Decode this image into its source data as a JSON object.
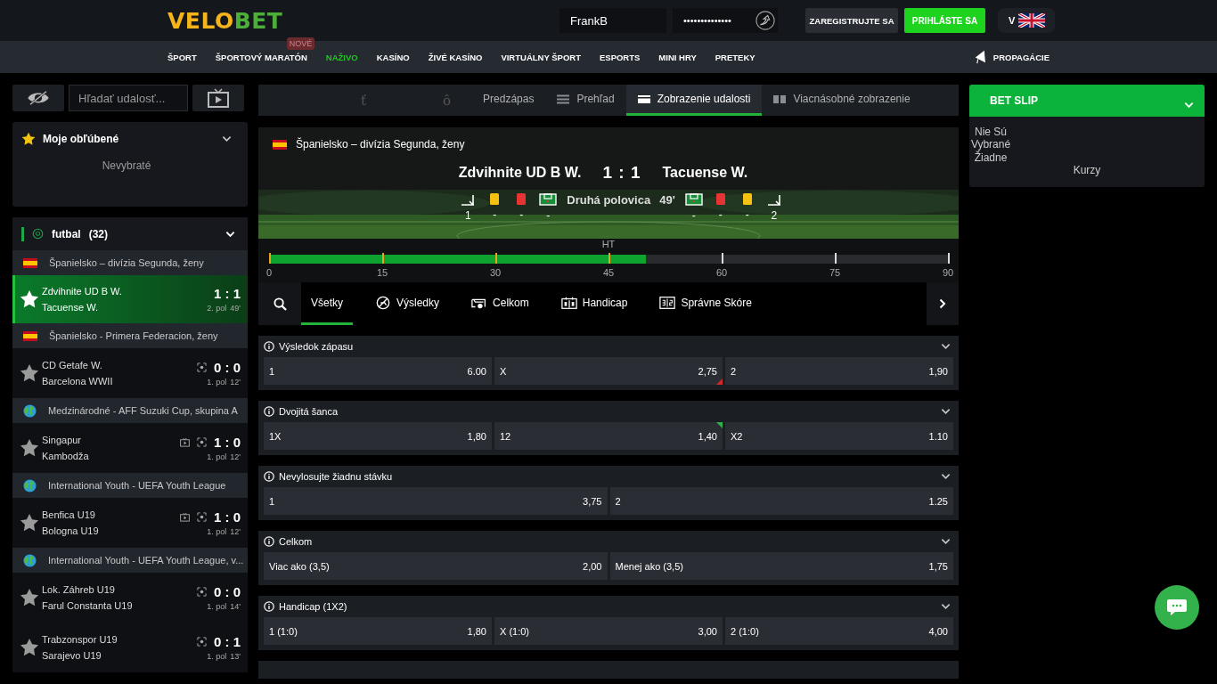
{
  "header": {
    "logo": {
      "first": "VELO",
      "second": "BET"
    },
    "username": {
      "value": "FrankB"
    },
    "password": {
      "value": "••••••••••••••"
    },
    "register_button": "ZAREGISTRUJTE SA",
    "login_button": "PRIHLÁSTE SA",
    "language": "V"
  },
  "nav": {
    "items": [
      {
        "label": "ŠPORT",
        "selected": false
      },
      {
        "label": "ŠPORTOVÝ MARATÓN",
        "selected": false,
        "badge": "NOVÉ"
      },
      {
        "label": "NAŽIVO",
        "selected": true
      },
      {
        "label": "KASÍNO",
        "selected": false
      },
      {
        "label": "ŽIVÉ KASÍNO",
        "selected": false
      },
      {
        "label": "VIRTUÁLNY ŠPORT",
        "selected": false
      },
      {
        "label": "ESPORTS",
        "selected": false
      },
      {
        "label": "MINI HRY",
        "selected": false
      },
      {
        "label": "PRETEKY",
        "selected": false
      }
    ],
    "promotions": "PROPAGÁCIE"
  },
  "sidebar": {
    "search": {
      "placeholder": "Hľadať udalosť..."
    },
    "favorites": {
      "title": "Moje obľúbené",
      "empty": "Nevybraté"
    },
    "sport": {
      "name": "futbal",
      "count": "(32)"
    },
    "groups": [
      {
        "league": "Španielsko – divízia Segunda, ženy",
        "kind": "spain",
        "matches": [
          {
            "home": "Zdvihnite UD B W.",
            "away": "Tacuense W.",
            "score": "1 : 1",
            "period": "2. pol",
            "minute": "49'",
            "selected": true,
            "tv": false,
            "tracker": false
          }
        ]
      },
      {
        "league": "Španielsko - Primera Federacion, ženy",
        "kind": "spain",
        "matches": [
          {
            "home": "CD Getafe W.",
            "away": "Barcelona WWII",
            "score": "0 : 0",
            "period": "1. pol",
            "minute": "12'",
            "selected": false,
            "tv": false,
            "tracker": true
          }
        ]
      },
      {
        "league": "Medzinárodné - AFF Suzuki Cup, skupina A",
        "kind": "world",
        "matches": [
          {
            "home": "Singapur",
            "away": "Kambodža",
            "score": "1 : 0",
            "period": "1. pol",
            "minute": "12'",
            "selected": false,
            "tv": true,
            "tracker": true
          }
        ]
      },
      {
        "league": "International Youth - UEFA Youth League",
        "kind": "world",
        "matches": [
          {
            "home": "Benfica U19",
            "away": "Bologna U19",
            "score": "1 : 0",
            "period": "1. pol",
            "minute": "12'",
            "selected": false,
            "tv": true,
            "tracker": true
          }
        ]
      },
      {
        "league": "International Youth - UEFA Youth League, v...",
        "kind": "world",
        "matches": [
          {
            "home": "Lok. Záhreb U19",
            "away": "Farul Constanta U19",
            "score": "0 : 0",
            "period": "1. pol",
            "minute": "14'",
            "selected": false,
            "tv": false,
            "tracker": true
          },
          {
            "home": "Trabzonspor U19",
            "away": "Sarajevo U19",
            "score": "0 : 1",
            "period": "1. pol",
            "minute": "13'",
            "selected": false,
            "tv": false,
            "tracker": true
          }
        ]
      }
    ]
  },
  "view_tabs": [
    {
      "kind": "glyph",
      "label": "ť",
      "selected": false
    },
    {
      "kind": "glyph",
      "label": "ô",
      "selected": false
    },
    {
      "kind": "plain",
      "label": "Predzápas",
      "selected": false
    },
    {
      "kind": "list",
      "label": "Prehľad",
      "selected": false
    },
    {
      "kind": "single",
      "label": "Zobrazenie udalosti",
      "selected": true
    },
    {
      "kind": "multi",
      "label": "Viacnásobné zobrazenie",
      "selected": false
    }
  ],
  "scoreboard": {
    "league": "Španielsko – divízia Segunda, ženy",
    "kind": "spain",
    "home": "Zdvihnite UD B W.",
    "score": "1 : 1",
    "away": "Tacuense W.",
    "period": "Druhá polovica",
    "minute": "49'",
    "home_stats": [
      {
        "kind": "corner",
        "value": "1"
      },
      {
        "kind": "yellow",
        "value": "-"
      },
      {
        "kind": "red",
        "value": "-"
      },
      {
        "kind": "penalty",
        "value": "-"
      }
    ],
    "away_stats": [
      {
        "kind": "penalty",
        "value": "-"
      },
      {
        "kind": "red",
        "value": "-"
      },
      {
        "kind": "yellow",
        "value": "-"
      },
      {
        "kind": "corner",
        "value": "2"
      }
    ]
  },
  "timeline": {
    "half_label": "HT",
    "level": 0.555,
    "ticks": [
      "0",
      "15",
      "30",
      "45",
      "60",
      "75",
      "90"
    ]
  },
  "market_tabs": [
    {
      "kind": "plain",
      "label": "Všetky",
      "selected": true
    },
    {
      "kind": "whistle",
      "label": "Výsledky",
      "selected": false
    },
    {
      "kind": "goal",
      "label": "Celkom",
      "selected": false
    },
    {
      "kind": "scoreboard",
      "label": "Handicap",
      "selected": false
    },
    {
      "kind": "digits",
      "label": "Správne Skóre",
      "selected": false
    }
  ],
  "markets": [
    {
      "title": "Výsledok zápasu",
      "odds": [
        {
          "label": "1",
          "value": "6.00",
          "dropped": false,
          "raised": false
        },
        {
          "label": "X",
          "value": "2,75",
          "dropped": true,
          "raised": false
        },
        {
          "label": "2",
          "value": "1,90",
          "dropped": false,
          "raised": false
        }
      ]
    },
    {
      "title": "Dvojitá šanca",
      "odds": [
        {
          "label": "1X",
          "value": "1,80",
          "dropped": false,
          "raised": false
        },
        {
          "label": "12",
          "value": "1,40",
          "dropped": false,
          "raised": true
        },
        {
          "label": "X2",
          "value": "1.10",
          "dropped": false,
          "raised": false
        }
      ]
    },
    {
      "title": "Nevylosujte žiadnu stávku",
      "odds": [
        {
          "label": "1",
          "value": "3,75",
          "dropped": false,
          "raised": false
        },
        {
          "label": "2",
          "value": "1.25",
          "dropped": false,
          "raised": false
        }
      ]
    },
    {
      "title": "Celkom",
      "odds": [
        {
          "label": "Viac ako (3,5)",
          "value": "2,00",
          "dropped": false,
          "raised": false
        },
        {
          "label": "Menej ako (3,5)",
          "value": "1,75",
          "dropped": false,
          "raised": false
        }
      ]
    },
    {
      "title": "Handicap (1X2)",
      "odds": [
        {
          "label": "1 (1:0)",
          "value": "1,80",
          "dropped": false,
          "raised": false
        },
        {
          "label": "X (1:0)",
          "value": "3,00",
          "dropped": false,
          "raised": false
        },
        {
          "label": "2 (1:0)",
          "value": "4,00",
          "dropped": false,
          "raised": false
        }
      ]
    }
  ],
  "bet_slip": {
    "title": "BET SLIP",
    "empty_message": "Nie Sú Vybrané Žiadne",
    "odds_label": "Kurzy"
  }
}
